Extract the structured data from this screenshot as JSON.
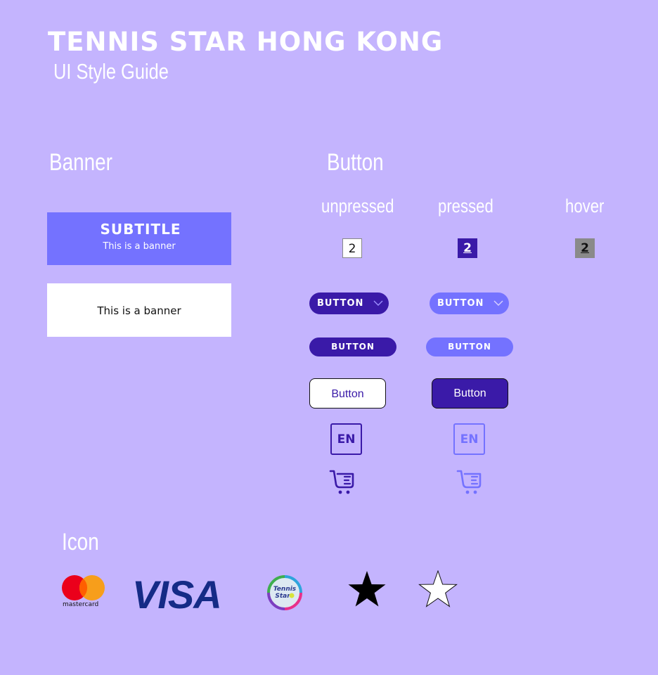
{
  "header": {
    "brand": "Tennis Star Hong Kong",
    "subtitle": "UI Style Guide"
  },
  "sections": {
    "banner": "Banner",
    "button": "Button",
    "icon": "Icon"
  },
  "states": {
    "unpressed": "unpressed",
    "pressed": "pressed",
    "hover": "hover"
  },
  "banners": {
    "primary": {
      "title": "Subtitle",
      "text": "This is a banner"
    },
    "secondary": {
      "text": "This is a banner"
    }
  },
  "pagination": {
    "unpressed": "2",
    "pressed": "2",
    "hover": "2"
  },
  "buttons": {
    "dropdown_unpressed": "Button",
    "dropdown_pressed": "Button",
    "pill_unpressed": "Button",
    "pill_pressed": "Button",
    "outline_unpressed": "Button",
    "outline_pressed": "Button",
    "lang_unpressed": "EN",
    "lang_pressed": "EN"
  },
  "icons": {
    "mastercard_label": "mastercard",
    "visa_label": "VISA",
    "logo_text_1": "Tennis",
    "logo_text_2": "Star",
    "names": [
      "mastercard-icon",
      "visa-icon",
      "tennis-star-logo-icon",
      "star-filled-icon",
      "star-outline-icon",
      "cart-icon",
      "chevron-down-icon"
    ]
  },
  "colors": {
    "background": "#c4b4fe",
    "primary": "#3a1aa8",
    "secondary": "#7472ff",
    "hover": "#8a8a8a",
    "visa_blue": "#152b86"
  }
}
